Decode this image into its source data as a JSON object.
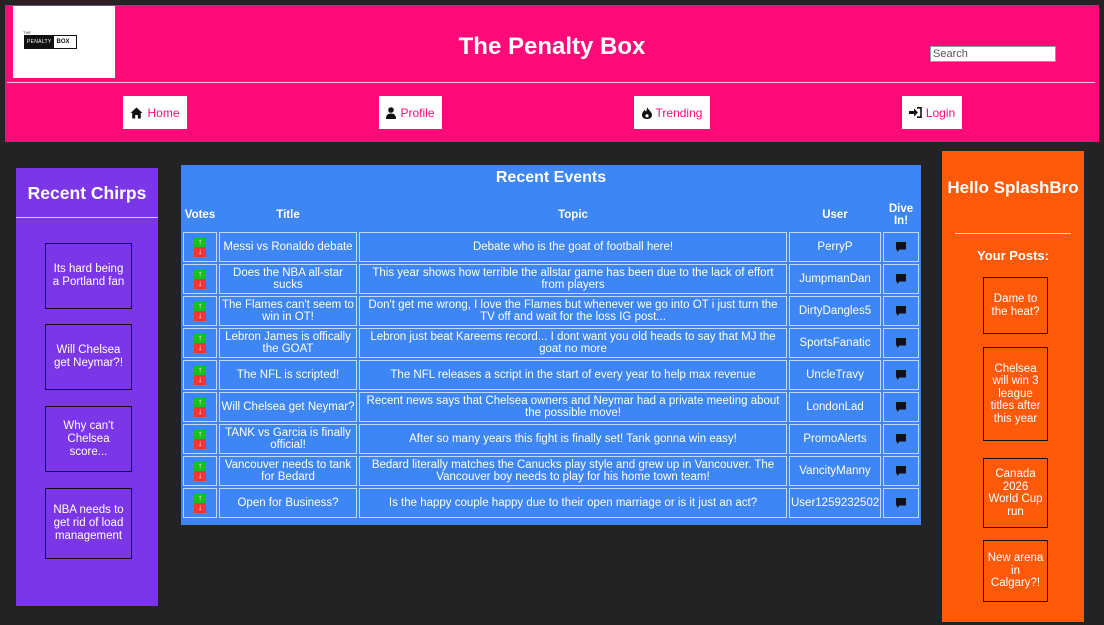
{
  "header": {
    "title": "The Penalty Box",
    "logo_small_text": "THE",
    "logo_penalty": "PENALTY",
    "logo_box": "BOX",
    "search_placeholder": "Search",
    "color": "#ff0a78"
  },
  "nav": [
    {
      "label": "Home",
      "icon": "home-icon"
    },
    {
      "label": "Profile",
      "icon": "user-icon"
    },
    {
      "label": "Trending",
      "icon": "flame-icon"
    },
    {
      "label": "Login",
      "icon": "login-icon"
    }
  ],
  "left_sidebar": {
    "title": "Recent Chirps",
    "color": "#7b36e8",
    "chirps": [
      "Its hard being a Portland fan",
      "Will Chelsea get Neymar?!",
      "Why can't Chelsea score...",
      "NBA needs to get rid of load management"
    ]
  },
  "right_sidebar": {
    "greeting": "Hello SplashBro",
    "posts_heading": "Your Posts:",
    "color": "#ff5a0a",
    "posts": [
      "Dame to the heat?",
      "Chelsea will win 3 league titles after this year",
      "Canada 2026 World Cup run",
      "New arena in Calgary?!"
    ]
  },
  "events": {
    "title": "Recent Events",
    "color": "#3d86f3",
    "columns": [
      "Votes",
      "Title",
      "Topic",
      "User",
      "Dive In!"
    ],
    "up_glyph": "↑",
    "down_glyph": "↓",
    "rows": [
      {
        "title": "Messi vs Ronaldo debate",
        "topic": "Debate who is the goat of football here!",
        "user": "PerryP"
      },
      {
        "title": "Does the NBA all-star sucks",
        "topic": "This year shows how terrible the allstar game has been due to the lack of effort from players",
        "user": "JumpmanDan"
      },
      {
        "title": "The Flames can't seem to win in OT!",
        "topic": "Don't get me wrong, I love the Flames but whenever we go into OT i just turn the TV off and wait for the loss IG post...",
        "user": "DirtyDangles5"
      },
      {
        "title": "Lebron James is offically the GOAT",
        "topic": "Lebron just beat Kareems record... I dont want you old heads to say that MJ the goat no more",
        "user": "SportsFanatic"
      },
      {
        "title": "The NFL is scripted!",
        "topic": "The NFL releases a script in the start of every year to help max revenue",
        "user": "UncleTravy"
      },
      {
        "title": "Will Chelsea get Neymar?",
        "topic": "Recent news says that Chelsea owners and Neymar had a private meeting about the possible move!",
        "user": "LondonLad"
      },
      {
        "title": "TANK vs Garcia is finally official!",
        "topic": "After so many years this fight is finally set! Tank gonna win easy!",
        "user": "PromoAlerts"
      },
      {
        "title": "Vancouver needs to tank for Bedard",
        "topic": "Bedard literally matches the Canucks play style and grew up in Vancouver. The Vancouver boy needs to play for his home town team!",
        "user": "VancityManny"
      },
      {
        "title": "Open for Business?",
        "topic": "Is the happy couple happy due to their open marriage or is it just an act?",
        "user": "User1259232502"
      }
    ]
  }
}
